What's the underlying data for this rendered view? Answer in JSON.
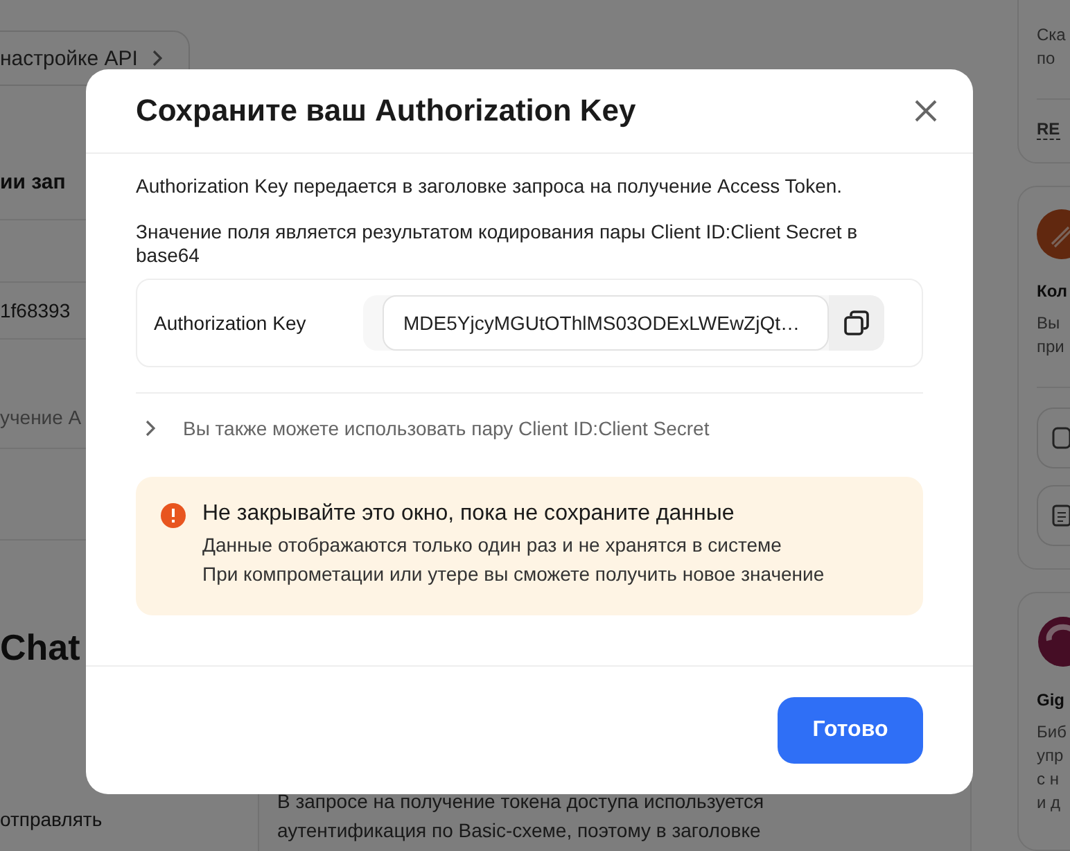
{
  "background": {
    "left": {
      "api_button": "настройке API",
      "section_heading": "ии зап",
      "rows": [
        "1f68393",
        "учение A"
      ],
      "chat_heading": "Chat",
      "text_lines": [
        "отправлять"
      ]
    },
    "info_card": {
      "lines": [
        "В запросе на получение токена доступа используется",
        "аутентификация по Basic-схеме, поэтому в заголовке"
      ]
    },
    "right_cards": [
      {
        "kind": "text",
        "lines": [
          "Ска",
          "по"
        ],
        "link": "RE"
      },
      {
        "kind": "tools",
        "title": "Кол",
        "lines": [
          "Вы",
          "при"
        ]
      },
      {
        "kind": "logo",
        "title": "Gig",
        "lines": [
          "Биб",
          "упр",
          "с н",
          "и д"
        ]
      }
    ]
  },
  "modal": {
    "title": "Сохраните ваш Authorization Key",
    "description": [
      "Authorization Key передается в заголовке запроса на получение Access Token.",
      "Значение поля является результатом кодирования пары Client ID:Client Secret в base64"
    ],
    "key_field": {
      "label": "Authorization Key",
      "value": "MDE5YjcyMGUtOThlMS03ODExLWEwZjQt…"
    },
    "expander": {
      "label": "Вы также можете использовать пару Client ID:Client Secret",
      "expanded": false
    },
    "warning": {
      "title": "Не закрывайте это окно, пока не сохраните данные",
      "lines": [
        "Данные отображаются только один раз и не хранятся в системе",
        "При компрометации или утере вы сможете получить новое значение"
      ]
    },
    "button": "Готово"
  }
}
